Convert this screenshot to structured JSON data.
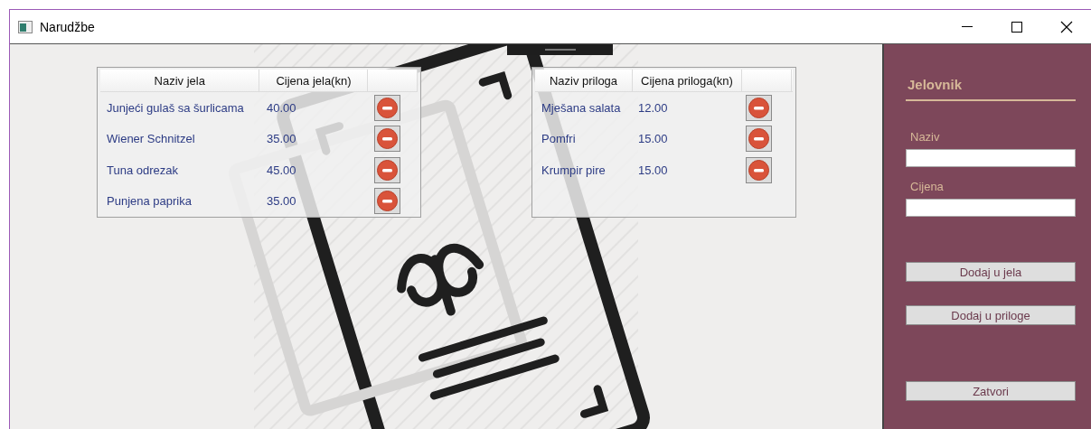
{
  "window": {
    "title": "Narudžbe"
  },
  "dishes_table": {
    "columns": [
      "Naziv jela",
      "Cijena jela(kn)"
    ],
    "rows": [
      {
        "name": "Junjeći gulaš sa šurlicama",
        "price": "40.00"
      },
      {
        "name": "Wiener Schnitzel",
        "price": "35.00"
      },
      {
        "name": "Tuna odrezak",
        "price": "45.00"
      },
      {
        "name": "Punjena paprika",
        "price": "35.00"
      }
    ]
  },
  "sides_table": {
    "columns": [
      "Naziv priloga",
      "Cijena priloga(kn)"
    ],
    "rows": [
      {
        "name": "Mješana salata",
        "price": "12.00"
      },
      {
        "name": "Pomfri",
        "price": "15.00"
      },
      {
        "name": "Krumpir pire",
        "price": "15.00"
      }
    ]
  },
  "sidebar": {
    "title": "Jelovnik",
    "fields": [
      {
        "label": "Naziv"
      },
      {
        "label": "Cijena"
      }
    ],
    "buttons": [
      "Dodaj u jela",
      "Dodaj u priloge",
      "Zatvori"
    ]
  }
}
